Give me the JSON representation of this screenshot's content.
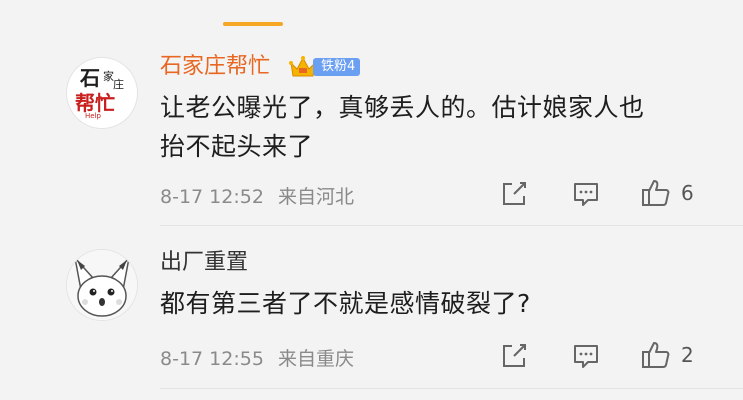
{
  "comments": [
    {
      "username": "石家庄帮忙",
      "fan_badge": "铁粉4",
      "lines": [
        "让老公曝光了，真够丢人的。估计娘家人也",
        "抬不起头来了"
      ],
      "date_time": "8-17 12:52",
      "location": "来自河北",
      "like_count": "6",
      "avatar_text": {
        "top": "石",
        "top2": "家",
        "top3": "庄",
        "bottom": "帮忙",
        "tag": "Help"
      }
    },
    {
      "username": "出厂重置",
      "lines": [
        "都有第三者了不就是感情破裂了?"
      ],
      "date_time": "8-17 12:55",
      "location": "来自重庆",
      "like_count": "2"
    }
  ],
  "colors": {
    "vip_name": "#e86722",
    "fan_badge": "#6a9ff1",
    "accent_tab": "#f5a623",
    "meta_text": "#8a8a8a"
  },
  "icons": [
    "share-icon",
    "comment-icon",
    "like-icon",
    "crown-icon"
  ]
}
